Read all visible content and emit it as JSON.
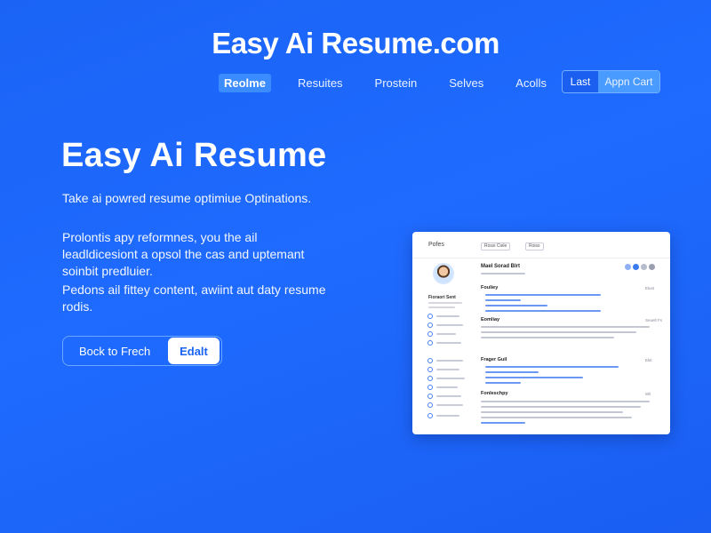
{
  "site": {
    "title": "Easy Ai Resume.com"
  },
  "nav": {
    "items": [
      {
        "label": "Reolme",
        "active": true
      },
      {
        "label": "Resuites",
        "active": false
      },
      {
        "label": "Prostein",
        "active": false
      },
      {
        "label": "Selves",
        "active": false
      },
      {
        "label": "Acolls",
        "active": false
      }
    ],
    "last_label": "Last",
    "cta_label": "Appn Cart"
  },
  "hero": {
    "title": "Easy Ai Resume",
    "paragraphs": [
      "Take ai powred resume optimiue Optinations.",
      "Prolontis apy reformnes, you the ail leadldicesiont a opsol the cas and uptemant soinbit predluier.",
      "Pedons ail fittey content, awiint aut daty resume rodis."
    ],
    "cta_secondary": "Bock to Frech",
    "cta_primary": "Edalt"
  },
  "preview": {
    "brand": "Pofes",
    "tabs": [
      "Rossi Ciele",
      "Roiss"
    ],
    "name": "Mael Sorad Blrt",
    "side_name": "Fioraori Sent",
    "sections": [
      {
        "title": "Fouliey",
        "right": "Elust"
      },
      {
        "title": "Eomliay",
        "right": "Seuelt Fs"
      },
      {
        "title": "Frager Guil",
        "right": "Ekit"
      },
      {
        "title": "Fonleschpy",
        "right": "Wil"
      }
    ],
    "colors": {
      "accent": "#1f6bff",
      "card": "#ffffff",
      "link": "#6a98f2"
    }
  }
}
